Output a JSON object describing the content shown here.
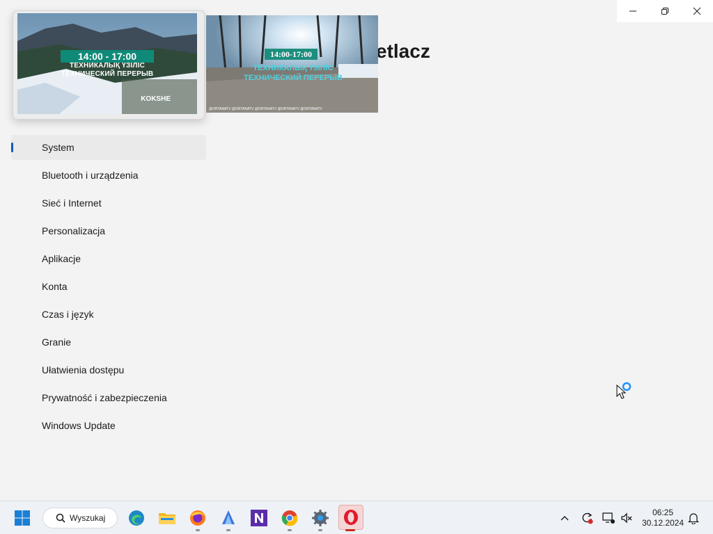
{
  "window": {
    "title": "etlacz",
    "controls": [
      "minimize-icon",
      "restore-icon",
      "close-icon"
    ]
  },
  "thumbnails": [
    {
      "time": "14:00 - 17:00",
      "line1": "ТЕХНИКАЛЫҚ ҮЗІЛІС",
      "line2": "ТЕХНИЧЕСКИЙ ПЕРЕРЫВ",
      "brand": "KOKSHE"
    },
    {
      "time": "14:00-17:00",
      "line1": "ТЕХНИКАЛЫҚ ҮЗІЛІС",
      "line2": "ТЕХНИЧЕСКИЙ ПЕРЕРЫВ",
      "footer": "@ORTANATV   @ORTANATV   @ORTANATV   @ORTANATV   @ORTANATV"
    }
  ],
  "nav": {
    "items": [
      {
        "label": "System",
        "selected": true
      },
      {
        "label": "Bluetooth i urządzenia"
      },
      {
        "label": "Sieć i Internet"
      },
      {
        "label": "Personalizacja"
      },
      {
        "label": "Aplikacje"
      },
      {
        "label": "Konta"
      },
      {
        "label": "Czas i język"
      },
      {
        "label": "Granie"
      },
      {
        "label": "Ułatwienia dostępu"
      },
      {
        "label": "Prywatność i zabezpieczenia"
      },
      {
        "label": "Windows Update"
      }
    ]
  },
  "taskbar": {
    "search_label": "Wyszukaj",
    "apps": [
      "start-icon",
      "edge-icon",
      "file-explorer-icon",
      "firefox-icon",
      "app-blue-icon",
      "app-n-icon",
      "chrome-icon",
      "settings-icon",
      "opera-icon"
    ],
    "time": "06:25",
    "date": "30.12.2024"
  },
  "colors": {
    "accent": "#005fb8",
    "background": "#f3f3f3",
    "taskbar": "#eef1f6"
  }
}
